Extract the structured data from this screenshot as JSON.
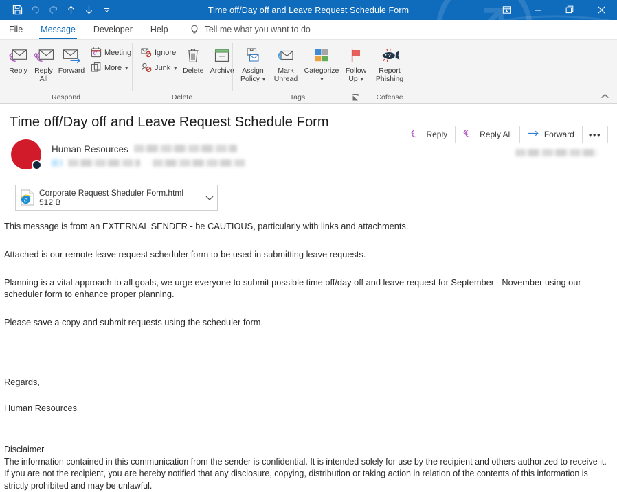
{
  "window": {
    "title": "Time off/Day off and Leave Request Schedule Form",
    "quick_access": [
      {
        "name": "save-icon",
        "label": "Save",
        "dimmed": false
      },
      {
        "name": "undo-icon",
        "label": "Undo",
        "dimmed": true
      },
      {
        "name": "redo-icon",
        "label": "Redo",
        "dimmed": true
      },
      {
        "name": "previous-item-icon",
        "label": "Previous Item",
        "dimmed": false
      },
      {
        "name": "next-item-icon",
        "label": "Next Item",
        "dimmed": false
      },
      {
        "name": "customize-quick-access-icon",
        "label": "Customize Quick Access Toolbar",
        "dimmed": false
      }
    ],
    "controls": {
      "restore_down": "Restore Down",
      "minimize": "–",
      "maximize": "❐",
      "close": "✕"
    },
    "accent": "#0f6cbd"
  },
  "tabs": [
    {
      "label": "File",
      "active": false
    },
    {
      "label": "Message",
      "active": true
    },
    {
      "label": "Developer",
      "active": false
    },
    {
      "label": "Help",
      "active": false
    }
  ],
  "tell_me": {
    "label": "Tell me what you want to do",
    "icon": "lightbulb-icon"
  },
  "ribbon": {
    "collapse_label": "Collapse the Ribbon",
    "groups": [
      {
        "label": "Respond",
        "big_buttons": [
          {
            "label": "Reply",
            "icon": "reply-icon"
          },
          {
            "label": "Reply\nAll",
            "line1": "Reply",
            "line2": "All",
            "icon": "reply-all-icon"
          },
          {
            "label": "Forward",
            "icon": "forward-icon"
          }
        ],
        "small_buttons": [
          {
            "label": "Meeting",
            "icon": "meeting-icon",
            "caret": false
          },
          {
            "label": "More",
            "icon": "more-icon",
            "caret": true
          }
        ]
      },
      {
        "label": "Delete",
        "small_buttons": [
          {
            "label": "Ignore",
            "icon": "ignore-icon",
            "caret": false
          },
          {
            "label": "Junk",
            "icon": "junk-icon",
            "caret": true
          }
        ],
        "big_buttons": [
          {
            "label": "Delete",
            "icon": "delete-icon"
          },
          {
            "label": "Archive",
            "icon": "archive-icon"
          }
        ]
      },
      {
        "label": "Tags",
        "dialog_launcher": "tags-dialog-launcher-icon",
        "big_buttons": [
          {
            "line1": "Assign",
            "line2": "Policy",
            "icon": "assign-policy-icon",
            "caret": true
          },
          {
            "line1": "Mark",
            "line2": "Unread",
            "icon": "mark-unread-icon",
            "caret": false
          },
          {
            "line1": "Categorize",
            "line2": "",
            "icon": "categorize-icon",
            "caret": true
          },
          {
            "line1": "Follow",
            "line2": "Up",
            "icon": "follow-up-icon",
            "caret": true
          }
        ]
      },
      {
        "label": "Cofense",
        "big_buttons": [
          {
            "line1": "Report",
            "line2": "Phishing",
            "icon": "report-phishing-fish-icon",
            "caret": false
          }
        ]
      }
    ]
  },
  "message": {
    "subject": "Time off/Day off and Leave Request Schedule Form",
    "sender_name": "Human Resources",
    "sender_address_redacted": true,
    "recipient_redacted": true,
    "timestamp_redacted": true,
    "avatar": {
      "name": "avatar",
      "color": "#d11a2a",
      "presence_color": "#16263d"
    },
    "actions": [
      {
        "label": "Reply",
        "icon": "reply-icon"
      },
      {
        "label": "Reply All",
        "icon": "reply-all-icon"
      },
      {
        "label": "Forward",
        "icon": "forward-icon"
      },
      {
        "label": "•••",
        "icon": "more-actions-icon"
      }
    ],
    "attachment": {
      "name": "Corporate Request Sheduler Form.html",
      "size": "512 B",
      "icon": "internet-explorer-html-file-icon",
      "caret": "chevron-down-icon"
    },
    "body": {
      "external_warning": "This message is from an EXTERNAL SENDER - be CAUTIOUS, particularly with links and attachments.",
      "paragraph_1": "Attached is our remote leave request scheduler form to be used in submitting leave requests.",
      "paragraph_2": "Planning is a vital approach to all goals, we urge everyone to submit possible time off/day off and leave request for September - November using our scheduler form to enhance proper planning.",
      "paragraph_3": "Please save a copy and submit requests using the scheduler form.",
      "signoff": "Regards,",
      "signature": "Human Resources",
      "disclaimer_title": "Disclaimer",
      "disclaimer_text": "The information contained in this communication from the sender is confidential. It is intended solely for use by the recipient and others authorized to receive it. If you are not the recipient, you are hereby notified that any disclosure, copying, distribution or taking action in relation of the contents of this information is strictly prohibited and may be unlawful."
    }
  }
}
